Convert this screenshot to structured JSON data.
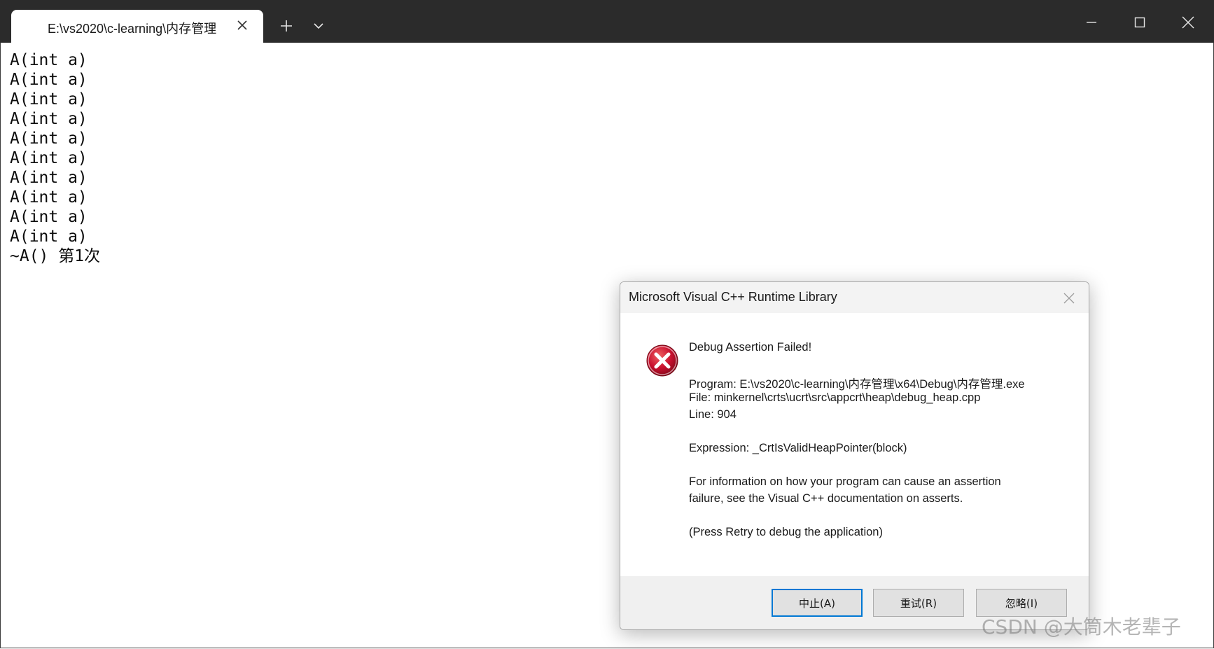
{
  "window": {
    "tab_title": "E:\\vs2020\\c-learning\\内存管理"
  },
  "console": {
    "lines": [
      "A(int a)",
      "A(int a)",
      "A(int a)",
      "A(int a)",
      "A(int a)",
      "A(int a)",
      "A(int a)",
      "A(int a)",
      "A(int a)",
      "A(int a)",
      "~A() 第1次"
    ]
  },
  "dialog": {
    "title": "Microsoft Visual C++ Runtime Library",
    "heading": "Debug Assertion Failed!",
    "program": "Program: E:\\vs2020\\c-learning\\内存管理\\x64\\Debug\\内存管理.exe",
    "file": "File: minkernel\\crts\\ucrt\\src\\appcrt\\heap\\debug_heap.cpp",
    "line": "Line: 904",
    "expression": "Expression: _CrtIsValidHeapPointer(block)",
    "info_line1": "For information on how your program can cause an assertion",
    "info_line2": "failure, see the Visual C++ documentation on asserts.",
    "retry_hint": "(Press Retry to debug the application)",
    "buttons": {
      "abort": "中止(A)",
      "retry": "重试(R)",
      "ignore": "忽略(I)"
    }
  },
  "watermark": "CSDN @大筒木老辈子",
  "icons": {
    "tab_close": "close-icon",
    "new_tab": "plus-icon",
    "tab_dropdown": "chevron-down-icon",
    "minimize": "minimize-icon",
    "maximize": "maximize-icon",
    "window_close": "close-icon",
    "dialog_close": "close-icon",
    "dialog_status": "error-icon"
  },
  "colors": {
    "titlebar": "#2b2b2b",
    "error_red": "#c8102e",
    "default_button_border": "#0078d4"
  }
}
